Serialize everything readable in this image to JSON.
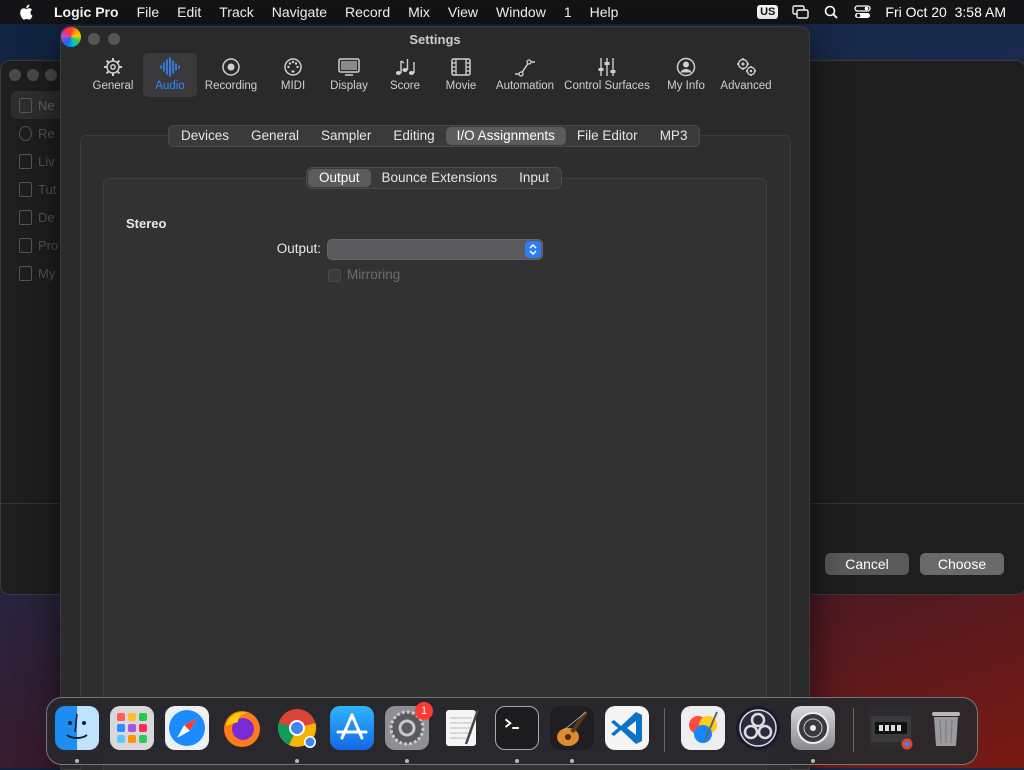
{
  "menubar": {
    "app_name": "Logic Pro",
    "items": [
      "File",
      "Edit",
      "Track",
      "Navigate",
      "Record",
      "Mix",
      "View",
      "Window",
      "1",
      "Help"
    ],
    "input_source": "US",
    "datetime": "Fri Oct 20  3:58 AM",
    "icons": [
      "apple-icon",
      "screen-mirroring-icon",
      "search-icon",
      "control-center-icon"
    ]
  },
  "background_window": {
    "sidebar_items": [
      "Ne",
      "Re",
      "Liv",
      "Tut",
      "De",
      "Pro",
      "My"
    ],
    "cancel_label": "Cancel",
    "choose_label": "Choose"
  },
  "settings": {
    "title": "Settings",
    "toolbar": [
      {
        "label": "General",
        "icon": "gear-icon"
      },
      {
        "label": "Audio",
        "icon": "waveform-icon"
      },
      {
        "label": "Recording",
        "icon": "record-icon"
      },
      {
        "label": "MIDI",
        "icon": "midi-icon"
      },
      {
        "label": "Display",
        "icon": "display-icon"
      },
      {
        "label": "Score",
        "icon": "music-notes-icon"
      },
      {
        "label": "Movie",
        "icon": "film-icon"
      },
      {
        "label": "Automation",
        "icon": "automation-icon"
      },
      {
        "label": "Control Surfaces",
        "icon": "sliders-icon"
      },
      {
        "label": "My Info",
        "icon": "person-icon"
      },
      {
        "label": "Advanced",
        "icon": "gears-icon"
      }
    ],
    "selected_toolbar": "Audio",
    "tabs": [
      "Devices",
      "General",
      "Sampler",
      "Editing",
      "I/O Assignments",
      "File Editor",
      "MP3"
    ],
    "selected_tab": "I/O Assignments",
    "subtabs": [
      "Output",
      "Bounce Extensions",
      "Input"
    ],
    "selected_subtab": "Output",
    "section_title": "Stereo",
    "output_label": "Output:",
    "output_value": "",
    "mirroring_label": "Mirroring",
    "mirroring_checked": false
  },
  "dock": {
    "apps": [
      {
        "name": "Finder",
        "icon": "finder-icon",
        "running": true
      },
      {
        "name": "Launchpad",
        "icon": "launchpad-icon",
        "running": false
      },
      {
        "name": "Safari",
        "icon": "safari-icon",
        "running": false
      },
      {
        "name": "Firefox",
        "icon": "firefox-icon",
        "running": false
      },
      {
        "name": "Google Chrome",
        "icon": "chrome-icon",
        "running": true
      },
      {
        "name": "App Store",
        "icon": "app-store-icon",
        "running": false
      },
      {
        "name": "System Settings",
        "icon": "system-settings-icon",
        "running": true,
        "badge": "1"
      },
      {
        "name": "TextEdit",
        "icon": "textedit-icon",
        "running": false
      },
      {
        "name": "Terminal",
        "icon": "terminal-icon",
        "running": true
      },
      {
        "name": "GarageBand",
        "icon": "garageband-icon",
        "running": true
      },
      {
        "name": "Visual Studio Code",
        "icon": "vscode-icon",
        "running": false
      },
      {
        "name": "Pixelmator",
        "icon": "pixelmator-icon",
        "running": false
      },
      {
        "name": "OBS",
        "icon": "obs-icon",
        "running": false
      },
      {
        "name": "Logic Pro",
        "icon": "logic-pro-icon",
        "running": true
      },
      {
        "name": "Chrome Window",
        "icon": "chrome-window-icon",
        "running": false
      },
      {
        "name": "Trash",
        "icon": "trash-icon",
        "running": false
      }
    ]
  },
  "colors": {
    "accent": "#2f8bff",
    "menubar_bg": "#141416",
    "window_bg": "#2a2a2a",
    "badge": "#ff3b30"
  }
}
